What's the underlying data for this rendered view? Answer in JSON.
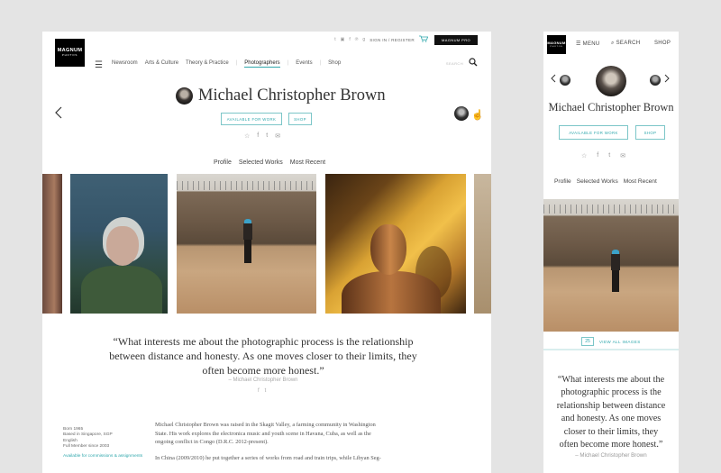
{
  "brand": {
    "line1": "MAGNUM",
    "line2": "PHOTOS"
  },
  "desktop": {
    "utility": {
      "social_icons": [
        "t",
        "▣",
        "f",
        "℗",
        "g"
      ],
      "signin_label": "SIGN IN / REGISTER",
      "cart_icon": "cart-icon",
      "pro_label": "MAGNUM PRO"
    },
    "nav": {
      "menu_icon": "☰",
      "items": [
        "Newsroom",
        "Arts & Culture",
        "Theory & Practice",
        "Photographers",
        "Events",
        "Shop"
      ],
      "active": "Photographers",
      "search_label": "SEARCH"
    },
    "photographer": {
      "name": "Michael Christopher Brown",
      "available_label": "AVAILABLE FOR WORK",
      "shop_label": "SHOP",
      "share_icons": [
        "☆",
        "f",
        "t",
        "✉"
      ]
    },
    "tabs": [
      "Profile",
      "Selected Works",
      "Most Recent"
    ],
    "quote": {
      "text": "“What interests me about the photographic process is the relationship between distance and honesty. As one moves closer to their limits, they often become more honest.”",
      "author": "– Michael Christopher Brown",
      "share_icons": [
        "f",
        "t"
      ]
    },
    "meta": {
      "born": "Born 1965",
      "based": "Based in Singapore, SGP",
      "language": "English",
      "membership": "Full Member since 2003",
      "availability": "Available for commissions & assignments"
    },
    "bio": {
      "p1": "Michael Christopher Brown was raised in the Skagit Valley, a farming community in Washington State. His work explores the electronica music and youth scene in Havana, Cuba, as well as the ongoing conflict in Congo (D.R.C. 2012-present).",
      "p2": "In China (2009/2010) he put together a series of works from road and train trips, while Libyan Seg-"
    }
  },
  "mobile": {
    "menu_label": "☰ MENU",
    "search_label": "⌕ SEARCH",
    "shop_label": "SHOP",
    "name": "Michael Christopher Brown",
    "available_label": "AVAILABLE FOR WORK",
    "shop_button": "SHOP",
    "share_icons": [
      "☆",
      "f",
      "t",
      "✉"
    ],
    "tabs": [
      "Profile",
      "Selected Works",
      "Most Recent"
    ],
    "image_count": "25",
    "view_all_label": "VIEW ALL IMAGES",
    "quote": {
      "text": "“What interests me about the photographic process is the relationship between distance and honesty. As one moves closer to their limits, they often become more honest.”",
      "author": "– Michael Christopher Brown"
    }
  },
  "colors": {
    "accent": "#2fa7ac",
    "background": "#e4e4e4",
    "text": "#333333"
  }
}
